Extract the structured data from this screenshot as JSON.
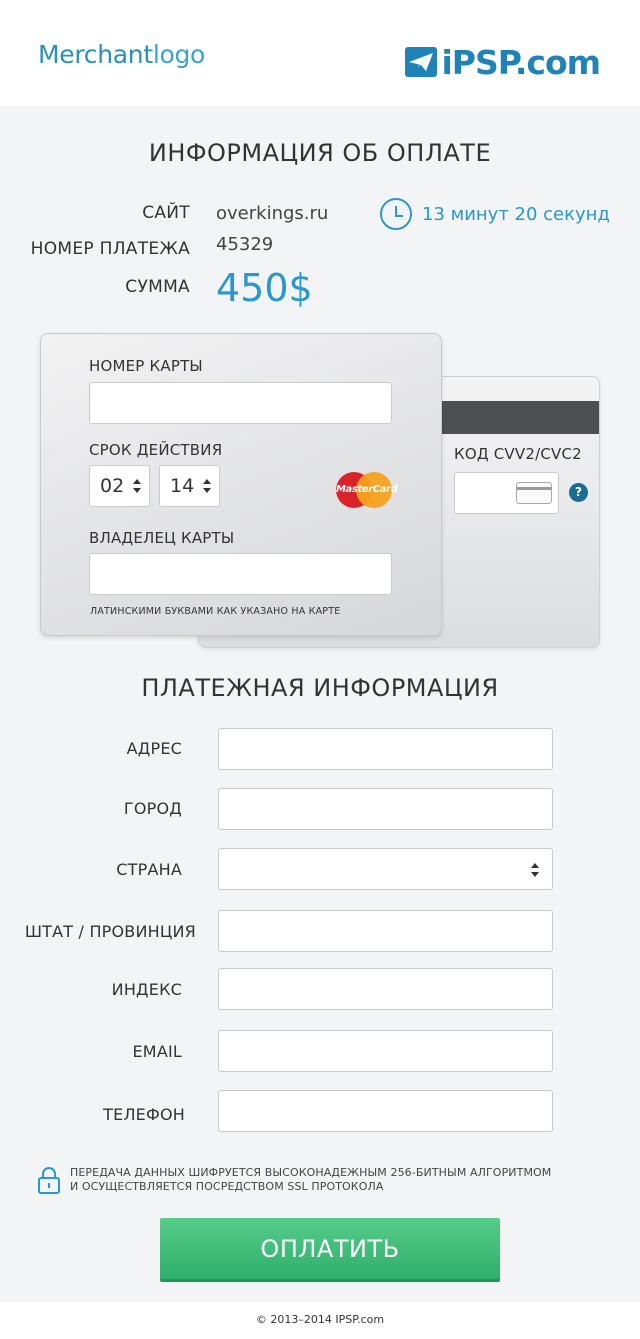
{
  "header": {
    "merchant_logo_bold": "Merchant",
    "merchant_logo_light": "logo",
    "brand": "iPSP.com"
  },
  "payment_info": {
    "title": "ИНФОРМАЦИЯ ОБ ОПЛАТЕ",
    "site_label": "САЙТ",
    "site_value": "overkings.ru",
    "payment_number_label": "НОМЕР ПЛАТЕЖА",
    "payment_number_value": "45329",
    "amount_label": "СУММА",
    "amount_value": "450$",
    "timer_text": "13 минут 20 секунд"
  },
  "card": {
    "card_number_label": "НОМЕР КАРТЫ",
    "card_number_value": "",
    "expiry_label": "СРОК ДЕЙСТВИЯ",
    "expiry_month": "02",
    "expiry_year": "14",
    "holder_label": "ВЛАДЕЛЕЦ КАРТЫ",
    "holder_value": "",
    "holder_hint": "ЛАТИНСКИМИ БУКВАМИ КАК УКАЗАНО НА КАРТЕ",
    "brand_logo": "MasterCard",
    "cvv_label": "КОД CVV2/CVC2",
    "cvv_value": "",
    "help_symbol": "?"
  },
  "billing": {
    "title": "ПЛАТЕЖНАЯ ИНФОРМАЦИЯ",
    "fields": [
      {
        "label": "АДРЕС",
        "value": ""
      },
      {
        "label": "ГОРОД",
        "value": ""
      },
      {
        "label": "СТРАНА",
        "value": ""
      },
      {
        "label": "ШТАТ / ПРОВИНЦИЯ",
        "value": ""
      },
      {
        "label": "ИНДЕКС",
        "value": ""
      },
      {
        "label": "EMAIL",
        "value": ""
      },
      {
        "label": "ТЕЛЕФОН",
        "value": ""
      }
    ]
  },
  "security": {
    "line1": "ПЕРЕДАЧА ДАННЫХ ШИФРУЕТСЯ ВЫСОКОНАДЕЖНЫМ 256-БИТНЫМ АЛГОРИТМОМ",
    "line2": "И ОСУЩЕСТВЛЯЕТСЯ ПОСРЕДСТВОМ SSL ПРОТОКОЛА"
  },
  "pay_button_label": "ОПЛАТИТЬ",
  "footer_text": "© 2013–2014 IPSP.com",
  "colors": {
    "accent": "#2b97cc",
    "button": "#3dbb77",
    "brand": "#1f83b8"
  }
}
